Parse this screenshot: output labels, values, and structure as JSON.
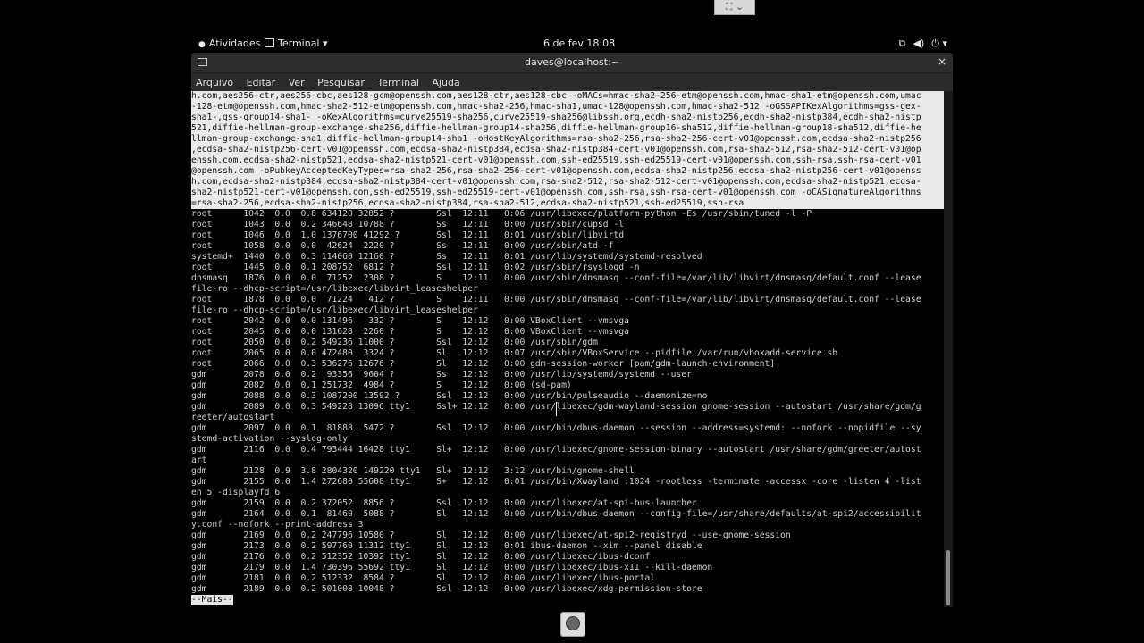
{
  "topbar": {
    "activities": "Atividades",
    "app_menu": "Terminal ▾",
    "clock": "6 de fev  18:08",
    "sys_icons": [
      "network-icon",
      "volume-icon",
      "power-icon"
    ]
  },
  "window": {
    "title": "daves@localhost:~",
    "close": "×",
    "menu": [
      "Arquivo",
      "Editar",
      "Ver",
      "Pesquisar",
      "Terminal",
      "Ajuda"
    ]
  },
  "console": {
    "highlight_lines": [
      "h.com,aes256-ctr,aes256-cbc,aes128-gcm@openssh.com,aes128-ctr,aes128-cbc -oMACs=hmac-sha2-256-etm@openssh.com,hmac-sha1-etm@openssh.com,umac",
      "-128-etm@openssh.com,hmac-sha2-512-etm@openssh.com,hmac-sha2-256,hmac-sha1,umac-128@openssh.com,hmac-sha2-512 -oGSSAPIKexAlgorithms=gss-gex-",
      "sha1-,gss-group14-sha1- -oKexAlgorithms=curve25519-sha256,curve25519-sha256@libssh.org,ecdh-sha2-nistp256,ecdh-sha2-nistp384,ecdh-sha2-nistp",
      "521,diffie-hellman-group-exchange-sha256,diffie-hellman-group14-sha256,diffie-hellman-group16-sha512,diffie-hellman-group18-sha512,diffie-he",
      "llman-group-exchange-sha1,diffie-hellman-group14-sha1 -oHostKeyAlgorithms=rsa-sha2-256,rsa-sha2-256-cert-v01@openssh.com,ecdsa-sha2-nistp256",
      ",ecdsa-sha2-nistp256-cert-v01@openssh.com,ecdsa-sha2-nistp384,ecdsa-sha2-nistp384-cert-v01@openssh.com,rsa-sha2-512,rsa-sha2-512-cert-v01@op",
      "enssh.com,ecdsa-sha2-nistp521,ecdsa-sha2-nistp521-cert-v01@openssh.com,ssh-ed25519,ssh-ed25519-cert-v01@openssh.com,ssh-rsa,ssh-rsa-cert-v01",
      "@openssh.com -oPubkeyAcceptedKeyTypes=rsa-sha2-256,rsa-sha2-256-cert-v01@openssh.com,ecdsa-sha2-nistp256,ecdsa-sha2-nistp256-cert-v01@openss",
      "h.com,ecdsa-sha2-nistp384,ecdsa-sha2-nistp384-cert-v01@openssh.com,rsa-sha2-512,rsa-sha2-512-cert-v01@openssh.com,ecdsa-sha2-nistp521,ecdsa-",
      "sha2-nistp521-cert-v01@openssh.com,ssh-ed25519,ssh-ed25519-cert-v01@openssh.com,ssh-rsa,ssh-rsa-cert-v01@openssh.com -oCASignatureAlgorithms",
      "=rsa-sha2-256,ecdsa-sha2-nistp256,ecdsa-sha2-nistp384,rsa-sha2-512,ecdsa-sha2-nistp521,ssh-ed25519,ssh-rsa"
    ],
    "lines": [
      "root      1042  0.0  0.8 634120 32852 ?        Ssl  12:11   0:06 /usr/libexec/platform-python -Es /usr/sbin/tuned -l -P",
      "root      1043  0.0  0.2 346648 10788 ?        Ss   12:11   0:00 /usr/sbin/cupsd -l",
      "root      1046  0.0  1.0 1376700 41292 ?       Ssl  12:11   0:01 /usr/sbin/libvirtd",
      "root      1058  0.0  0.0  42624  2220 ?        Ss   12:11   0:00 /usr/sbin/atd -f",
      "systemd+  1440  0.0  0.3 114060 12160 ?        Ss   12:11   0:01 /usr/lib/systemd/systemd-resolved",
      "root      1445  0.0  0.1 208752  6812 ?        Ssl  12:11   0:02 /usr/sbin/rsyslogd -n",
      "dnsmasq   1876  0.0  0.0  71252  2308 ?        S    12:11   0:00 /usr/sbin/dnsmasq --conf-file=/var/lib/libvirt/dnsmasq/default.conf --lease",
      "file-ro --dhcp-script=/usr/libexec/libvirt_leaseshelper",
      "root      1878  0.0  0.0  71224   412 ?        S    12:11   0:00 /usr/sbin/dnsmasq --conf-file=/var/lib/libvirt/dnsmasq/default.conf --lease",
      "file-ro --dhcp-script=/usr/libexec/libvirt_leaseshelper",
      "root      2042  0.0  0.0 131496   332 ?        S    12:12   0:00 VBoxClient --vmsvga",
      "root      2045  0.0  0.0 131628  2260 ?        S    12:12   0:00 VBoxClient --vmsvga",
      "root      2050  0.0  0.2 549236 11000 ?        Ssl  12:12   0:00 /usr/sbin/gdm",
      "root      2065  0.0  0.0 472480  3324 ?        Sl   12:12   0:07 /usr/sbin/VBoxService --pidfile /var/run/vboxadd-service.sh",
      "root      2066  0.0  0.3 536276 12676 ?        Sl   12:12   0:00 gdm-session-worker [pam/gdm-launch-environment]",
      "gdm       2078  0.0  0.2  93356  9604 ?        Ss   12:12   0:00 /usr/lib/systemd/systemd --user",
      "gdm       2082  0.0  0.1 251732  4984 ?        S    12:12   0:00 (sd-pam)",
      "gdm       2088  0.0  0.3 1087200 13592 ?       Ssl  12:12   0:00 /usr/bin/pulseaudio --daemonize=no",
      "gdm       2089  0.0  0.3 549228 13096 tty1     Ssl+ 12:12   0:00 /usr/libexec/gdm-wayland-session gnome-session --autostart /usr/share/gdm/g",
      "reeter/autostart",
      "gdm       2097  0.0  0.1  81888  5472 ?        Ssl  12:12   0:00 /usr/bin/dbus-daemon --session --address=systemd: --nofork --nopidfile --sy",
      "stemd-activation --syslog-only",
      "gdm       2116  0.0  0.4 793444 16428 tty1     Sl+  12:12   0:00 /usr/libexec/gnome-session-binary --autostart /usr/share/gdm/greeter/autost",
      "art",
      "gdm       2128  0.9  3.8 2804320 149220 tty1   Sl+  12:12   3:12 /usr/bin/gnome-shell",
      "gdm       2155  0.0  1.4 272680 55608 tty1     S+   12:12   0:01 /usr/bin/Xwayland :1024 -rootless -terminate -accessx -core -listen 4 -list",
      "en 5 -displayfd 6",
      "gdm       2159  0.0  0.2 372052  8856 ?        Ssl  12:12   0:00 /usr/libexec/at-spi-bus-launcher",
      "gdm       2164  0.0  0.1  81460  5088 ?        Sl   12:12   0:00 /usr/bin/dbus-daemon --config-file=/usr/share/defaults/at-spi2/accessibilit",
      "y.conf --nofork --print-address 3",
      "gdm       2169  0.0  0.2 247796 10580 ?        Sl   12:12   0:00 /usr/libexec/at-spi2-registryd --use-gnome-session",
      "gdm       2173  0.0  0.2 597760 11312 tty1     Sl   12:12   0:01 ibus-daemon --xim --panel disable",
      "gdm       2176  0.0  0.2 512352 10392 tty1     Sl   12:12   0:00 /usr/libexec/ibus-dconf",
      "gdm       2179  0.0  1.4 730396 55692 tty1     Sl   12:12   0:00 /usr/libexec/ibus-x11 --kill-daemon",
      "gdm       2181  0.0  0.2 512332  8584 ?        Sl   12:12   0:00 /usr/libexec/ibus-portal",
      "gdm       2189  0.0  0.2 501008 10048 ?        Ssl  12:12   0:00 /usr/libexec/xdg-permission-store"
    ],
    "more": "--Mais--"
  },
  "overlay_label": "⛶ ⌄"
}
